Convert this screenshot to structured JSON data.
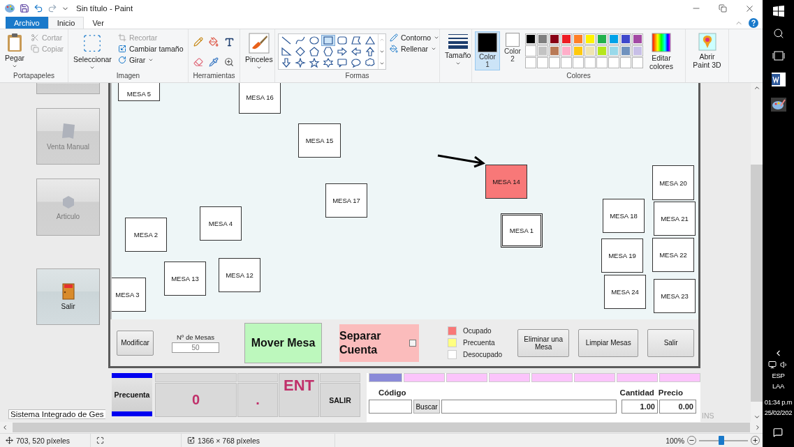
{
  "window": {
    "title": "Sin título - Paint"
  },
  "ribbon_tabs": [
    {
      "label": "Archivo",
      "selected": false,
      "kind": "file"
    },
    {
      "label": "Inicio",
      "selected": true,
      "kind": "tab"
    },
    {
      "label": "Ver",
      "selected": false,
      "kind": "tab"
    }
  ],
  "clipboard": {
    "title": "Portapapeles",
    "paste": "Pegar",
    "cut": {
      "label": "Cortar",
      "disabled": true
    },
    "copy": {
      "label": "Copiar",
      "disabled": true
    }
  },
  "image": {
    "title": "Imagen",
    "select": "Seleccionar",
    "crop": {
      "label": "Recortar",
      "disabled": true
    },
    "resize": {
      "label": "Cambiar tamaño",
      "disabled": false
    },
    "rotate": {
      "label": "Girar",
      "disabled": false
    }
  },
  "tools": {
    "title": "Herramientas"
  },
  "brushes": {
    "label": "Pinceles"
  },
  "shapes": {
    "title": "Formas",
    "outline": "Contorno",
    "fill": "Rellenar",
    "items": [
      {
        "kind": "line",
        "selected": false
      },
      {
        "kind": "curve",
        "selected": false
      },
      {
        "kind": "oval",
        "selected": false
      },
      {
        "kind": "rect",
        "selected": true
      },
      {
        "kind": "roundrect",
        "selected": false
      },
      {
        "kind": "polygon",
        "selected": false
      },
      {
        "kind": "triangle",
        "selected": false
      },
      {
        "kind": "righttriangle",
        "selected": false
      },
      {
        "kind": "diamond",
        "selected": false
      },
      {
        "kind": "pentagon",
        "selected": false
      },
      {
        "kind": "hexagon",
        "selected": false
      },
      {
        "kind": "arrowright",
        "selected": false
      },
      {
        "kind": "arrowleft",
        "selected": false
      },
      {
        "kind": "arrowup",
        "selected": false
      },
      {
        "kind": "arrowdown",
        "selected": false
      },
      {
        "kind": "star4",
        "selected": false
      },
      {
        "kind": "star5",
        "selected": false
      },
      {
        "kind": "star6",
        "selected": false
      },
      {
        "kind": "callout",
        "selected": false
      },
      {
        "kind": "ovalcallout",
        "selected": false
      },
      {
        "kind": "cloud",
        "selected": false
      }
    ]
  },
  "size": {
    "label": "Tamaño"
  },
  "colors": {
    "title": "Colores",
    "edit": "Editar colores",
    "slots": [
      {
        "label": "Color 1",
        "color": "#000000",
        "selected": true
      },
      {
        "label": "Color 2",
        "color": "#ffffff",
        "selected": false
      }
    ],
    "palette": [
      {
        "color": "#000000"
      },
      {
        "color": "#7f7f7f"
      },
      {
        "color": "#880015"
      },
      {
        "color": "#ed1c24"
      },
      {
        "color": "#ff7f27"
      },
      {
        "color": "#fff200"
      },
      {
        "color": "#22b14c"
      },
      {
        "color": "#00a2e8"
      },
      {
        "color": "#3f48cc"
      },
      {
        "color": "#a349a4"
      },
      {
        "color": "#ffffff"
      },
      {
        "color": "#c3c3c3"
      },
      {
        "color": "#b97a57"
      },
      {
        "color": "#ffaec9"
      },
      {
        "color": "#ffc90e"
      },
      {
        "color": "#efe4b0"
      },
      {
        "color": "#b5e61d"
      },
      {
        "color": "#99d9ea"
      },
      {
        "color": "#7092be"
      },
      {
        "color": "#c8bfe7"
      }
    ]
  },
  "paint3d": {
    "label": "Abrir Paint 3D"
  },
  "document": {
    "sidebar": [
      {
        "label": "Venta Manual",
        "disabled": true,
        "kind": "receipt"
      },
      {
        "label": "Articulo",
        "disabled": true,
        "kind": "hexagon"
      },
      {
        "label": "Salir",
        "disabled": false,
        "kind": "exit"
      }
    ],
    "app_title": "Sistema Integrado de Ges",
    "mesas": [
      {
        "label": "MESA 5",
        "occupied": false,
        "selected": false
      },
      {
        "label": "MESA 16",
        "occupied": false,
        "selected": false
      },
      {
        "label": "MESA 15",
        "occupied": false,
        "selected": false
      },
      {
        "label": "MESA 14",
        "occupied": true,
        "selected": false
      },
      {
        "label": "MESA 17",
        "occupied": false,
        "selected": false
      },
      {
        "label": "MESA 1",
        "occupied": false,
        "selected": true
      },
      {
        "label": "MESA 2",
        "occupied": false,
        "selected": false
      },
      {
        "label": "MESA 4",
        "occupied": false,
        "selected": false
      },
      {
        "label": "MESA 13",
        "occupied": false,
        "selected": false
      },
      {
        "label": "MESA 12",
        "occupied": false,
        "selected": false
      },
      {
        "label": "MESA 3",
        "occupied": false,
        "selected": false
      },
      {
        "label": "MESA 18",
        "occupied": false,
        "selected": false
      },
      {
        "label": "MESA 19",
        "occupied": false,
        "selected": false
      },
      {
        "label": "MESA 24",
        "occupied": false,
        "selected": false
      },
      {
        "label": "MESA 20",
        "occupied": false,
        "selected": false
      },
      {
        "label": "MESA 21",
        "occupied": false,
        "selected": false
      },
      {
        "label": "MESA 22",
        "occupied": false,
        "selected": false
      },
      {
        "label": "MESA 23",
        "occupied": false,
        "selected": false
      }
    ],
    "modify": "Modificar",
    "count_label": "Nº de Mesas",
    "count": "50",
    "move": "Mover Mesa",
    "split": {
      "label": "Separar Cuenta",
      "checked": false
    },
    "legend": [
      {
        "label": "Ocupado",
        "color": "#f87878",
        "kind": "occupied"
      },
      {
        "label": "Precuenta",
        "color": "#ffff80",
        "kind": "precheck"
      },
      {
        "label": "Desocupado",
        "color": "#ffffff",
        "kind": "free"
      }
    ],
    "actions": [
      "Eliminar una Mesa",
      "Limpiar Mesas",
      "Salir"
    ],
    "precheck": "Precuenta",
    "keys": [
      "0",
      ".",
      "ENT",
      "SALIR"
    ],
    "code_label": "Código",
    "search": "Buscar",
    "quantity_label": "Cantidad",
    "quantity": "1.00",
    "price_label": "Precio",
    "price": "0.00",
    "ins": "INS"
  },
  "status_bar": {
    "position": "703, 520 píxeles",
    "size": "1366 × 768 píxeles",
    "zoom": "100%",
    "zoom_slider": {
      "level": 0.46
    }
  },
  "taskbar": {
    "language": "ESP",
    "layout": "LAA",
    "time": "01:34 p.m",
    "date": "25/02/202"
  }
}
